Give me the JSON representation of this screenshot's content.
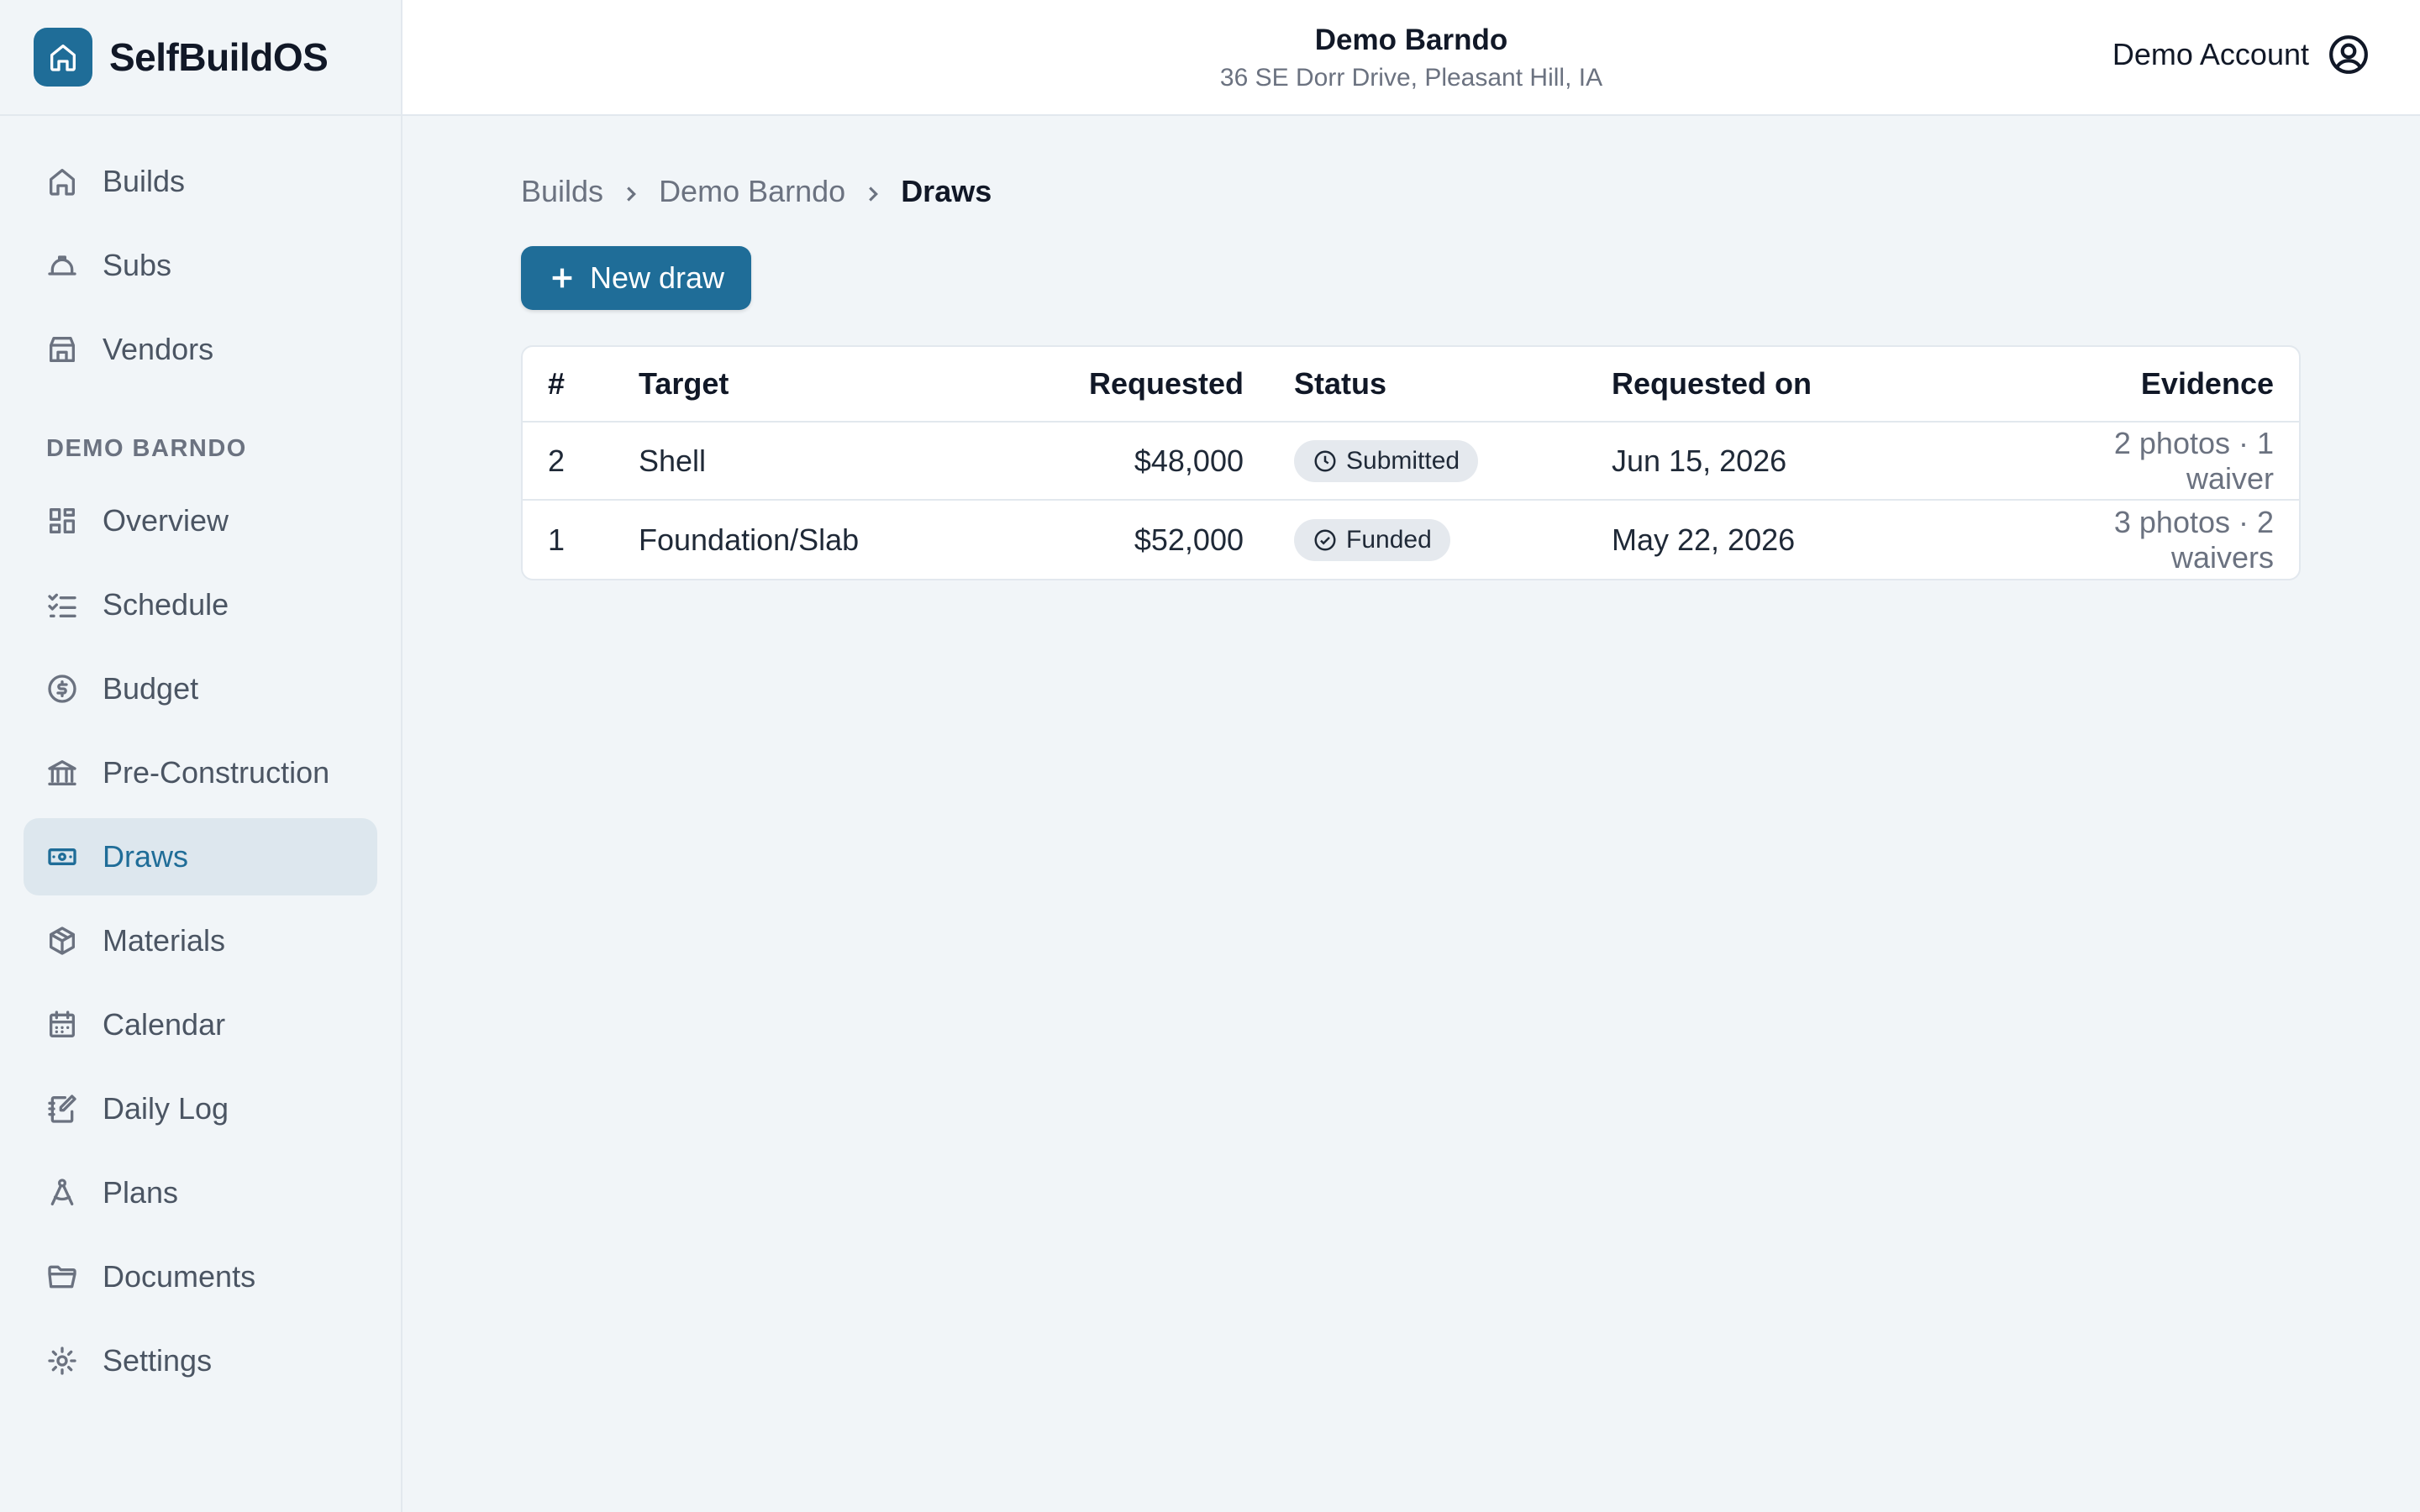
{
  "brand": {
    "name": "SelfBuildOS"
  },
  "header": {
    "title": "Demo Barndo",
    "subtitle": "36 SE Dorr Drive, Pleasant Hill, IA",
    "account": "Demo Account"
  },
  "sidebar": {
    "top_items": [
      {
        "label": "Builds",
        "icon": "home-icon"
      },
      {
        "label": "Subs",
        "icon": "hard-hat-icon"
      },
      {
        "label": "Vendors",
        "icon": "store-icon"
      }
    ],
    "section_label": "DEMO BARNDO",
    "items": [
      {
        "label": "Overview",
        "icon": "dashboard-icon"
      },
      {
        "label": "Schedule",
        "icon": "checklist-icon"
      },
      {
        "label": "Budget",
        "icon": "dollar-circle-icon"
      },
      {
        "label": "Pre-Construction",
        "icon": "bank-icon"
      },
      {
        "label": "Draws",
        "icon": "banknote-icon",
        "active": true
      },
      {
        "label": "Materials",
        "icon": "package-icon"
      },
      {
        "label": "Calendar",
        "icon": "calendar-icon"
      },
      {
        "label": "Daily Log",
        "icon": "notebook-pen-icon"
      },
      {
        "label": "Plans",
        "icon": "compass-icon"
      },
      {
        "label": "Documents",
        "icon": "folder-icon"
      },
      {
        "label": "Settings",
        "icon": "gear-icon"
      }
    ]
  },
  "breadcrumb": [
    "Builds",
    "Demo Barndo",
    "Draws"
  ],
  "actions": {
    "new_draw": "New draw"
  },
  "table": {
    "headers": [
      "#",
      "Target",
      "Requested",
      "Status",
      "Requested on",
      "Evidence"
    ],
    "rows": [
      {
        "num": "2",
        "target": "Shell",
        "requested": "$48,000",
        "status": "Submitted",
        "status_icon": "clock-icon",
        "date": "Jun 15, 2026",
        "evidence": "2 photos · 1 waiver"
      },
      {
        "num": "1",
        "target": "Foundation/Slab",
        "requested": "$52,000",
        "status": "Funded",
        "status_icon": "check-circle-icon",
        "date": "May 22, 2026",
        "evidence": "3 photos · 2 waivers"
      }
    ]
  },
  "colors": {
    "accent": "#1f6d98",
    "active_bg": "#dde7ee",
    "page_bg": "#f1f5f8"
  }
}
